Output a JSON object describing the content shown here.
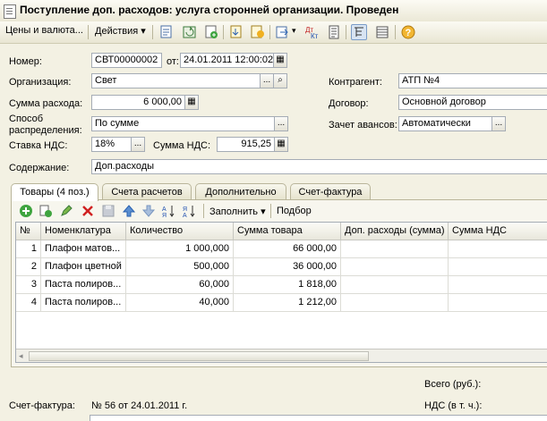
{
  "window": {
    "title": "Поступление доп. расходов: услуга сторонней организации. Проведен"
  },
  "toolbar": {
    "prices_label": "Цены и валюта...",
    "actions_label": "Действия",
    "icons": [
      "post-document-icon",
      "refresh-icon",
      "add-icon",
      "move-down-icon",
      "doc-movements-icon",
      "goto-icon",
      "debit-credit-icon",
      "report-icon",
      "structure-icon",
      "list-icon",
      "help-icon"
    ]
  },
  "header": {
    "number_label": "Номер:",
    "number_value": "СВТ00000002",
    "from_label": "от:",
    "date_value": "24.01.2011 12:00:02",
    "org_label": "Организация:",
    "org_value": "Свет",
    "counterparty_label": "Контрагент:",
    "counterparty_value": "АТП №4",
    "expense_sum_label": "Сумма расхода:",
    "expense_sum_value": "6 000,00",
    "contract_label": "Договор:",
    "contract_value": "Основной договор",
    "distribution_label_1": "Способ",
    "distribution_label_2": "распределения:",
    "distribution_value": "По сумме",
    "advances_label": "Зачет авансов:",
    "advances_value": "Автоматически",
    "vat_rate_label": "Ставка НДС:",
    "vat_rate_value": "18%",
    "vat_sum_label": "Сумма НДС:",
    "vat_sum_value": "915,25",
    "content_label": "Содержание:",
    "content_value": "Доп.расходы"
  },
  "tabs": [
    {
      "label": "Товары (4 поз.)",
      "active": true
    },
    {
      "label": "Счета расчетов",
      "active": false
    },
    {
      "label": "Дополнительно",
      "active": false
    },
    {
      "label": "Счет-фактура",
      "active": false
    }
  ],
  "table_toolbar": {
    "fill_label": "Заполнить",
    "select_label": "Подбор"
  },
  "table": {
    "columns": [
      "№",
      "Номенклатура",
      "Количество",
      "Сумма товара",
      "Доп. расходы (сумма)",
      "Сумма НДС"
    ],
    "rows": [
      [
        "1",
        "Плафон матов...",
        "1 000,000",
        "66 000,00",
        "",
        ""
      ],
      [
        "2",
        "Плафон цветной",
        "500,000",
        "36 000,00",
        "",
        ""
      ],
      [
        "3",
        "Паста полиров...",
        "60,000",
        "1 818,00",
        "",
        ""
      ],
      [
        "4",
        "Паста полиров...",
        "40,000",
        "1 212,00",
        "",
        ""
      ]
    ]
  },
  "footer": {
    "total_label": "Всего (руб.):",
    "vat_incl_label": "НДС (в т. ч.):",
    "invoice_label": "Счет-фактура:",
    "invoice_value": "№ 56 от 24.01.2011 г."
  }
}
